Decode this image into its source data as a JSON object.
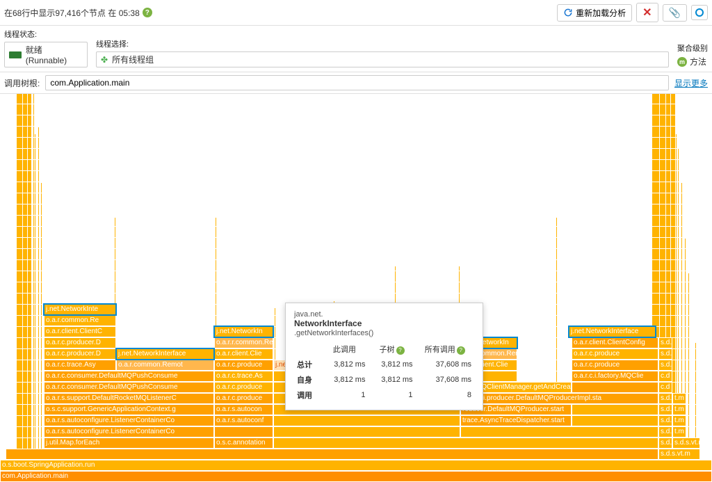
{
  "header": {
    "status_text": "在68行中显示97,416个节点 在 05:38",
    "reload_label": "重新加载分析"
  },
  "filters": {
    "state_label": "线程状态:",
    "state_value": "就绪(Runnable)",
    "select_label": "线程选择:",
    "select_value": "所有线程组",
    "agg_label": "聚合级别",
    "agg_value": "方法"
  },
  "root": {
    "label": "调用树根:",
    "value": "com.Application.main",
    "more": "显示更多"
  },
  "tooltip": {
    "pkg": "java.net.",
    "cls": "NetworkInterface",
    "method": ".getNetworkInterfaces()",
    "cols": {
      "this": "此调用",
      "tree": "子树",
      "all": "所有调用"
    },
    "rows": {
      "total": "总计",
      "self": "自身",
      "calls": "调用"
    },
    "vals": {
      "total": [
        "3,812 ms",
        "3,812 ms",
        "37,608 ms"
      ],
      "self": [
        "3,812 ms",
        "3,812 ms",
        "37,608 ms"
      ],
      "calls": [
        "1",
        "1",
        "8"
      ]
    }
  },
  "frames": {
    "root": "com.Application.main",
    "r1": "o.s.boot.SpringApplication.run",
    "map_foreach": "j.util.Map.forEach",
    "osc_autoconf": "o.s.c.annotation",
    "oars_autoconf1": "o.a.r.s.autoconfigure.ListenerContainerCo",
    "oars_autoconf2": "o.a.r.s.autoconfigure.ListenerContainerCo",
    "oars_autoconf3": "o.a.r.s.autoconf",
    "generic_ctx": "o.s.c.support.GenericApplicationContext.g",
    "oars_autoconf4": "o.a.r.s.autocon",
    "rocket_listener": "o.a.r.s.support.DefaultRocketMQListenerC",
    "push_consumer": "o.a.r.c.consumer.DefaultMQPushConsume",
    "push_consumer2": "o.a.r.c.consumer.DefaultMQPushConsume",
    "async_trace": "o.a.r.c.trace.Asy",
    "async_trace2": "o.a.r.c.trace.As",
    "producer": "o.a.r.c.producer.D",
    "producer2": "o.a.r.c.produce",
    "producer3": "o.a.r.c.producer",
    "client_cfg": "o.a.r.client.ClientC",
    "client_cfg2": "o.a.r.client.Clie",
    "client_cfg3": "o.a.r.client.ClientConfig",
    "common_remot": "o.a.r.common.Re",
    "common_remot2": "o.a.r.r.common.Remot",
    "common_remot3": "o.a.r.common.Remot",
    "netif": "j.net.NetworkInterface",
    "netif_short": "j.net.NetworkInte",
    "netif_short2": "j.net.NetworkIn",
    "netif_hl": "j.net.NetworkI",
    "factory": "o.a.r.c.i.factory.MQClie",
    "mq_mgr": "mpl.MQClientManager.getAndCreateM",
    "prod_impl": "o.a.r.c.i.producer.DefaultMQProducerImpl.sta",
    "prod_def": "roducer.DefaultMQProducer.start",
    "trace_disp": "trace.AsyncTraceDispatcher.start",
    "sds": "s.d.s",
    "sdsv": "s.d.s.vt.m",
    "tm": "t.m",
    "cd": "c.d"
  }
}
